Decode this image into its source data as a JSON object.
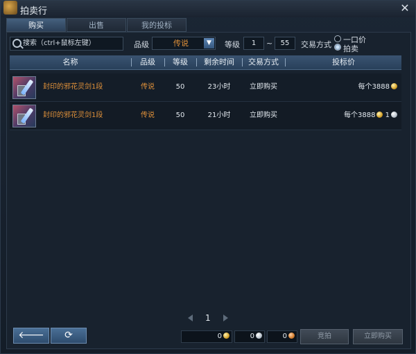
{
  "window": {
    "title": "拍卖行",
    "close_glyph": "✕"
  },
  "tabs": [
    {
      "label": "购买",
      "active": true
    },
    {
      "label": "出售",
      "active": false
    },
    {
      "label": "我的投标",
      "active": false
    }
  ],
  "filters": {
    "search_placeholder": "搜索（ctrl+鼠标左键）",
    "grade_label": "品级",
    "grade_value": "传说",
    "level_label": "等级",
    "level_min": "1",
    "level_sep": "~",
    "level_max": "55",
    "trade_label": "交易方式",
    "trade_options": [
      "一口价",
      "拍卖"
    ]
  },
  "table": {
    "headers": {
      "name": "名称",
      "grade": "品级",
      "level": "等级",
      "time": "剩余时间",
      "trade": "交易方式",
      "bid": "投标价"
    },
    "rows": [
      {
        "name": "封印的邪花灵剑1段",
        "grade": "传说",
        "level": "50",
        "time": "23小时",
        "trade": "立即购买",
        "price_prefix": "每个",
        "gold": "3888",
        "extra": ""
      },
      {
        "name": "封印的邪花灵剑1段",
        "grade": "传说",
        "level": "50",
        "time": "21小时",
        "trade": "立即购买",
        "price_prefix": "每个",
        "gold": "3888",
        "extra": "1"
      }
    ]
  },
  "pager": {
    "page": "1"
  },
  "footer": {
    "back_glyph": "🡐",
    "refresh_glyph": "⟳",
    "gold": "0",
    "silver": "0",
    "copper": "0",
    "bid_label": "竞拍",
    "buy_label": "立即购买"
  },
  "colors": {
    "accent": "#e0913a",
    "header": "#3a5471"
  }
}
